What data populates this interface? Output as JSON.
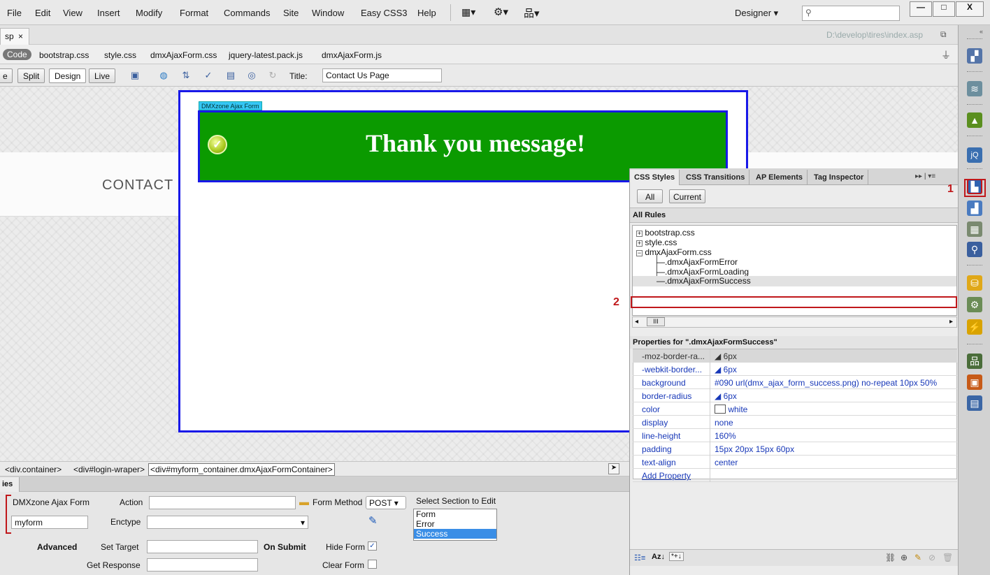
{
  "menu": [
    "File",
    "Edit",
    "View",
    "Insert",
    "Modify",
    "Format",
    "Commands",
    "Site",
    "Window",
    "Easy CSS3",
    "Help"
  ],
  "workspace": "Designer",
  "window_buttons": {
    "minimize": "—",
    "restore": "□",
    "close": "X"
  },
  "doc_tab": {
    "label": "sp",
    "close": "×",
    "path": "D:\\develop\\tires\\index.asp"
  },
  "related_files": {
    "source": "Code",
    "files": [
      "bootstrap.css",
      "style.css",
      "dmxAjaxForm.css",
      "jquery-latest.pack.js",
      "dmxAjaxForm.js"
    ]
  },
  "doc_toolbar": {
    "code_tail": "e",
    "split": "Split",
    "design": "Design",
    "live": "Live",
    "title_label": "Title:",
    "title_value": "Contact Us Page"
  },
  "design_view": {
    "contact_heading": "CONTACT",
    "form_tag": "DMXzone Ajax Form",
    "success_message": "Thank you message!"
  },
  "tag_selector": [
    "<div.container>",
    "<div#login-wraper>",
    "<div#myform_container.dmxAjaxFormContainer>"
  ],
  "properties": {
    "tab": "ies",
    "component": "DMXzone Ajax Form",
    "form_name": "myform",
    "action_label": "Action",
    "action_value": "",
    "method_label": "Form Method",
    "method_value": "POST",
    "enctype_label": "Enctype",
    "enctype_value": "",
    "select_section_label": "Select Section to Edit",
    "sections": [
      "Form",
      "Error",
      "Success"
    ],
    "selected_section": "Success",
    "advanced": "Advanced",
    "set_target": "Set Target",
    "get_response": "Get Response",
    "on_submit": "On Submit",
    "hide_form": "Hide Form",
    "hide_form_checked": true,
    "clear_form": "Clear Form",
    "clear_form_checked": false
  },
  "css_panel": {
    "tabs": [
      "CSS Styles",
      "CSS Transitions",
      "AP Elements",
      "Tag Inspector"
    ],
    "modes": [
      "All",
      "Current"
    ],
    "all_rules_heading": "All Rules",
    "rules": [
      {
        "sign": "+",
        "name": "bootstrap.css"
      },
      {
        "sign": "+",
        "name": "style.css"
      },
      {
        "sign": "−",
        "name": "dmxAjaxForm.css"
      },
      {
        "sign": "",
        "name": ".dmxAjaxFormError"
      },
      {
        "sign": "",
        "name": ".dmxAjaxFormLoading"
      },
      {
        "sign": "",
        "name": ".dmxAjaxFormSuccess"
      }
    ],
    "scroll_mark": "III",
    "properties_heading": "Properties for \".dmxAjaxFormSuccess\"",
    "props": [
      {
        "k": "-moz-border-ra...",
        "v": "6px"
      },
      {
        "k": "-webkit-border...",
        "v": "6px"
      },
      {
        "k": "background",
        "v": "#090 url(dmx_ajax_form_success.png) no-repeat 10px 50%"
      },
      {
        "k": "border-radius",
        "v": "6px"
      },
      {
        "k": "color",
        "v": "white"
      },
      {
        "k": "display",
        "v": "none"
      },
      {
        "k": "line-height",
        "v": "160%"
      },
      {
        "k": "padding",
        "v": "15px 20px 15px 60px"
      },
      {
        "k": "text-align",
        "v": "center"
      },
      {
        "k": "Add Property",
        "v": ""
      }
    ]
  },
  "callouts": {
    "one": "1",
    "two": "2"
  },
  "colors": {
    "success_green": "#0b9a00",
    "selection_blue": "#1818e8",
    "callout_red": "#c0181b",
    "form_tag": "#35c7f5"
  }
}
